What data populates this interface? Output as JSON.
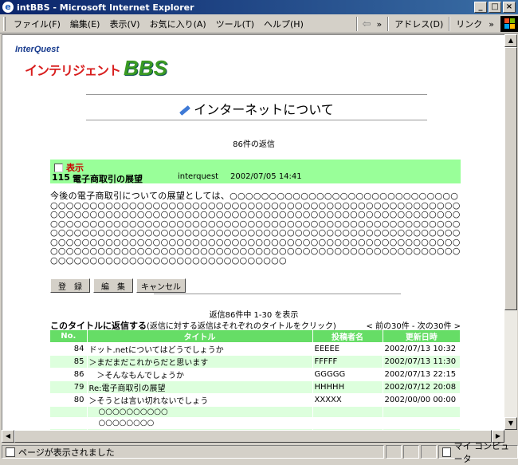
{
  "window": {
    "title": "intBBS - Microsoft Internet Explorer",
    "buttons": [
      "_",
      "□",
      "×"
    ]
  },
  "menu": {
    "items": [
      "ファイル(F)",
      "編集(E)",
      "表示(V)",
      "お気に入り(A)",
      "ツール(T)",
      "ヘルプ(H)"
    ],
    "back_arrow": "⇦",
    "more": "»",
    "address_label": "アドレス(D)",
    "links_label": "リンク",
    "more2": "»"
  },
  "logo": {
    "brand": "InterQuest",
    "title_jp": "インテリジェント",
    "title_bbs": "BBS"
  },
  "page": {
    "heading": "インターネットについて",
    "reply_count": "86件の返信"
  },
  "post": {
    "show_label": "表示",
    "number": "115",
    "title": "電子商取引の展望",
    "author": "interquest",
    "date": "2002/07/05 14:41",
    "body": "今後の電子商取引についての展望としては、○○○○○○○○○○○○○○○○○○○○○○○○○○○○○○○○○○○○○○○○○○○○○○○○○○○○○○○○○○○○○○○○○○○○○○○○○○○○○○○○○○○○○○○○○○○○○○○○○○○○○○○○○○○○○○○○○○○○○○○○○○○○○○○○○○○○○○○○○○○○○○○○○○○○○○○○○○○○○○○○○○○○○○○○○○○○○○○○○○○○○○○○○○○○○○○○○○○○○○○○○○○○○○○○○○○○○○○○○○○○○○○○○○○○○○○○○○○○○○○○○○○○○○○○○○○○○○○○○○○○○○○○○○○○○○○○○○○○○○○○○○○○○○○○○○○○○○○○○○○○○○○○○○○○○○○○○○○○○○○○○○○○○○○○○○○○○○○○○○○○○○○○○○○○○○○○○○○○○○○○○○○○○○○○○○○"
  },
  "buttons": {
    "register": "登　録",
    "edit": "編　集",
    "cancel": "キャンセル"
  },
  "replies": {
    "range": "返信86件中 1-30 を表示",
    "reply_link": "このタイトルに返信する",
    "reply_note": "(返信に対する返信はそれぞれのタイトルをクリック)",
    "pager": "< 前の30件 - 次の30件 >",
    "headers": [
      "No.",
      "タイトル",
      "投稿者名",
      "更新日時"
    ],
    "rows": [
      {
        "no": "84",
        "title": "ドット.netについてはどうでしょうか",
        "author": "EEEEE",
        "date": "2002/07/13 10:32"
      },
      {
        "no": "85",
        "title": "＞まだまだこれからだと思います",
        "author": "FFFFF",
        "date": "2002/07/13 11:30"
      },
      {
        "no": "86",
        "title": "　＞そんなもんでしょうか",
        "author": "GGGGG",
        "date": "2002/07/13 22:15"
      },
      {
        "no": "79",
        "title": "Re:電子商取引の展望",
        "author": "HHHHH",
        "date": "2002/07/12 20:08"
      },
      {
        "no": "80",
        "title": "＞そうとは言い切れないでしょう",
        "author": "XXXXX",
        "date": "2002/00/00 00:00"
      },
      {
        "no": "",
        "title": "○○○○○○○○○○",
        "author": "",
        "date": ""
      },
      {
        "no": "",
        "title": "○○○○○○○○",
        "author": "",
        "date": ""
      },
      {
        "no": "",
        "title": "　＞○○○○○○○○○○",
        "author": "",
        "date": ""
      }
    ]
  },
  "status": {
    "text": "ページが表示されました",
    "zone": "マイ コンピュータ"
  }
}
